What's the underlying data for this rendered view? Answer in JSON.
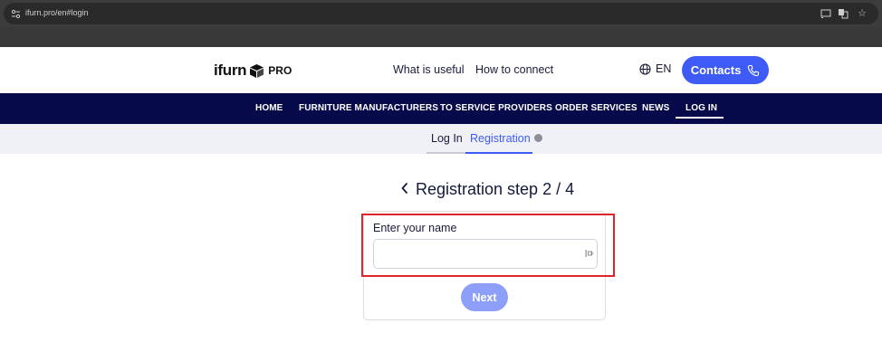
{
  "browser": {
    "url": "ifurn.pro/en#login"
  },
  "header": {
    "logo_text": "ifurn",
    "logo_suffix": "PRO",
    "links": [
      "What is useful",
      "How to connect"
    ],
    "language": "EN",
    "contacts_label": "Contacts"
  },
  "nav": {
    "items": [
      "HOME",
      "FURNITURE MANUFACTURERS",
      "TO SERVICE PROVIDERS",
      "ORDER SERVICES",
      "NEWS",
      "LOG IN"
    ],
    "active": "LOG IN"
  },
  "auth_tabs": {
    "login_label": "Log In",
    "registration_label": "Registration",
    "active": "Registration"
  },
  "form": {
    "step_title": "Registration step 2 / 4",
    "name_label": "Enter your name",
    "name_value": "",
    "next_label": "Next"
  },
  "colors": {
    "accent": "#3f5bf5",
    "nav_background": "#070a4a",
    "next_button_disabled": "#8e9ffa",
    "highlight": "#e0242b"
  },
  "icons": [
    "site-info-icon",
    "cast-icon",
    "translate-icon",
    "bookmark-star-icon",
    "logo-box-icon",
    "globe-icon",
    "phone-icon",
    "info-icon",
    "chevron-left-icon",
    "input-autofill-icon"
  ]
}
